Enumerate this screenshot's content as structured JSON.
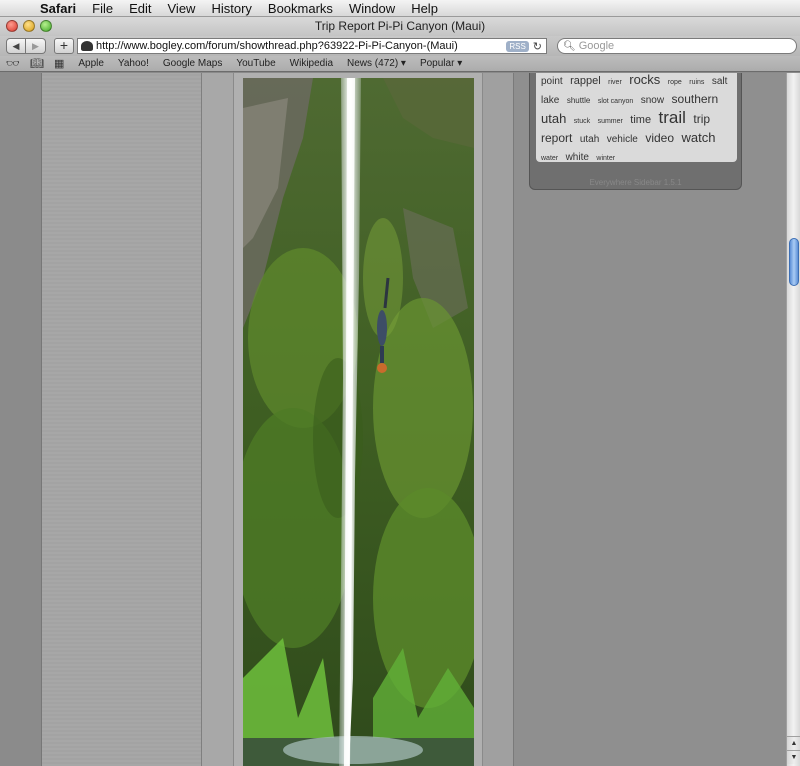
{
  "menubar": {
    "app": "Safari",
    "items": [
      "File",
      "Edit",
      "View",
      "History",
      "Bookmarks",
      "Window",
      "Help"
    ]
  },
  "window": {
    "title": "Trip Report Pi-Pi Canyon (Maui)"
  },
  "toolbar": {
    "back_icon": "back-arrow-icon",
    "forward_icon": "forward-arrow-icon",
    "add_label": "+",
    "url": "http://www.bogley.com/forum/showthread.php?63922-Pi-Pi-Canyon-(Maui)",
    "rss_label": "RSS",
    "search_placeholder": "Google"
  },
  "bookmarks": {
    "items": [
      "Apple",
      "Yahoo!",
      "Google Maps",
      "YouTube",
      "Wikipedia",
      "News (472) ▾",
      "Popular ▾"
    ]
  },
  "tag_cloud": {
    "tags": [
      {
        "text": "point",
        "size": "s10"
      },
      {
        "text": "rappel",
        "size": "s11"
      },
      {
        "text": "river",
        "size": "s7"
      },
      {
        "text": "rocks",
        "size": "s13"
      },
      {
        "text": "rope",
        "size": "s7"
      },
      {
        "text": "ruins",
        "size": "s7"
      },
      {
        "text": "salt",
        "size": "s10"
      },
      {
        "text": "lake",
        "size": "s10"
      },
      {
        "text": "shuttle",
        "size": "s8"
      },
      {
        "text": "slot canyon",
        "size": "s7"
      },
      {
        "text": "snow",
        "size": "s10"
      },
      {
        "text": "southern",
        "size": "s12"
      },
      {
        "text": "utah",
        "size": "s13"
      },
      {
        "text": "stuck",
        "size": "s7"
      },
      {
        "text": "summer",
        "size": "s7"
      },
      {
        "text": "time",
        "size": "s11"
      },
      {
        "text": "trail",
        "size": "s17"
      },
      {
        "text": "trip",
        "size": "s12"
      },
      {
        "text": "report",
        "size": "s12"
      },
      {
        "text": "utah",
        "size": "s10"
      },
      {
        "text": "vehicle",
        "size": "s10"
      },
      {
        "text": "video",
        "size": "s12"
      },
      {
        "text": "watch",
        "size": "s13"
      },
      {
        "text": "water",
        "size": "s7"
      },
      {
        "text": "white",
        "size": "s10"
      },
      {
        "text": "winter",
        "size": "s7"
      }
    ],
    "footer": "Everywhere Sidebar 1.5.1"
  },
  "scroll": {
    "position_fraction": 0.25
  },
  "colors": {
    "scroll_thumb": "#5c8fd6",
    "url_field": "#ffffff"
  }
}
